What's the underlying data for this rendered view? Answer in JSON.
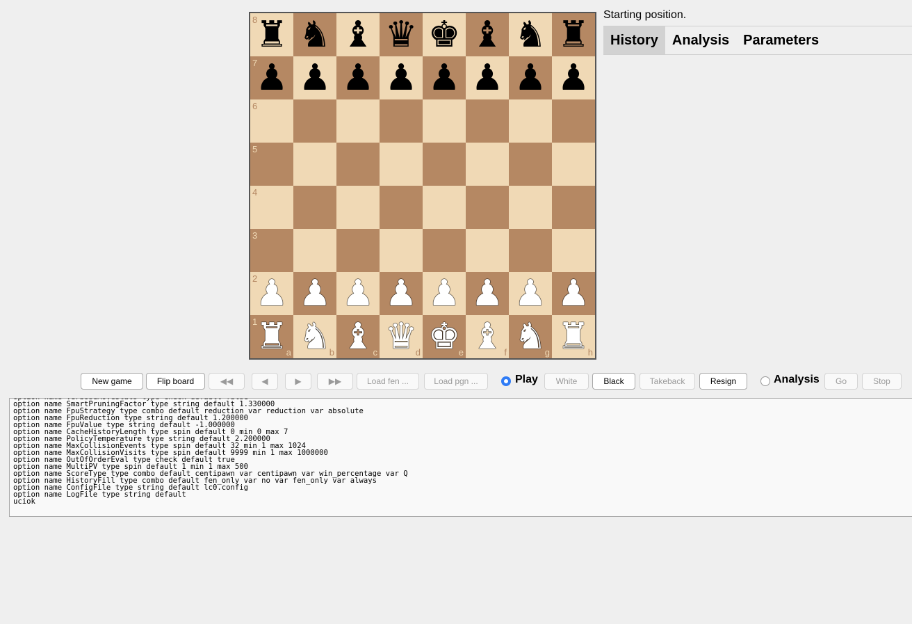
{
  "status": "Starting position.",
  "tabs": [
    {
      "label": "History",
      "active": true
    },
    {
      "label": "Analysis",
      "active": false
    },
    {
      "label": "Parameters",
      "active": false
    }
  ],
  "board": {
    "files": [
      "a",
      "b",
      "c",
      "d",
      "e",
      "f",
      "g",
      "h"
    ],
    "ranks": [
      "8",
      "7",
      "6",
      "5",
      "4",
      "3",
      "2",
      "1"
    ],
    "light_color": "#f0d9b5",
    "dark_color": "#b58863",
    "position": [
      [
        "bR",
        "bN",
        "bB",
        "bQ",
        "bK",
        "bB",
        "bN",
        "bR"
      ],
      [
        "bP",
        "bP",
        "bP",
        "bP",
        "bP",
        "bP",
        "bP",
        "bP"
      ],
      [
        "",
        "",
        "",
        "",
        "",
        "",
        "",
        ""
      ],
      [
        "",
        "",
        "",
        "",
        "",
        "",
        "",
        ""
      ],
      [
        "",
        "",
        "",
        "",
        "",
        "",
        "",
        ""
      ],
      [
        "",
        "",
        "",
        "",
        "",
        "",
        "",
        ""
      ],
      [
        "wP",
        "wP",
        "wP",
        "wP",
        "wP",
        "wP",
        "wP",
        "wP"
      ],
      [
        "wR",
        "wN",
        "wB",
        "wQ",
        "wK",
        "wB",
        "wN",
        "wR"
      ]
    ]
  },
  "controls": {
    "new_game": "New game",
    "flip_board": "Flip board",
    "first_move": "◀◀",
    "prev_move": "◀",
    "next_move": "▶",
    "last_move": "▶▶",
    "load_fen": "Load fen ...",
    "load_pgn": "Load pgn ...",
    "play_label": "Play",
    "white": "White",
    "black": "Black",
    "takeback": "Takeback",
    "resign": "Resign",
    "analysis_label": "Analysis",
    "go": "Go",
    "stop": "Stop",
    "mode_selected": "Play"
  },
  "console": {
    "lines": [
      "option name VerboseMoveStats type check default false",
      "option name SmartPruningFactor type string default 1.330000",
      "option name FpuStrategy type combo default reduction var reduction var absolute",
      "option name FpuReduction type string default 1.200000",
      "option name FpuValue type string default -1.000000",
      "option name CacheHistoryLength type spin default 0 min 0 max 7",
      "option name PolicyTemperature type string default 2.200000",
      "option name MaxCollisionEvents type spin default 32 min 1 max 1024",
      "option name MaxCollisionVisits type spin default 9999 min 1 max 1000000",
      "option name OutOfOrderEval type check default true",
      "option name MultiPV type spin default 1 min 1 max 500",
      "option name ScoreType type combo default centipawn var centipawn var win_percentage var Q",
      "option name HistoryFill type combo default fen_only var no var fen_only var always",
      "option name ConfigFile type string default lc0.config",
      "option name LogFile type string default",
      "uciok"
    ]
  }
}
